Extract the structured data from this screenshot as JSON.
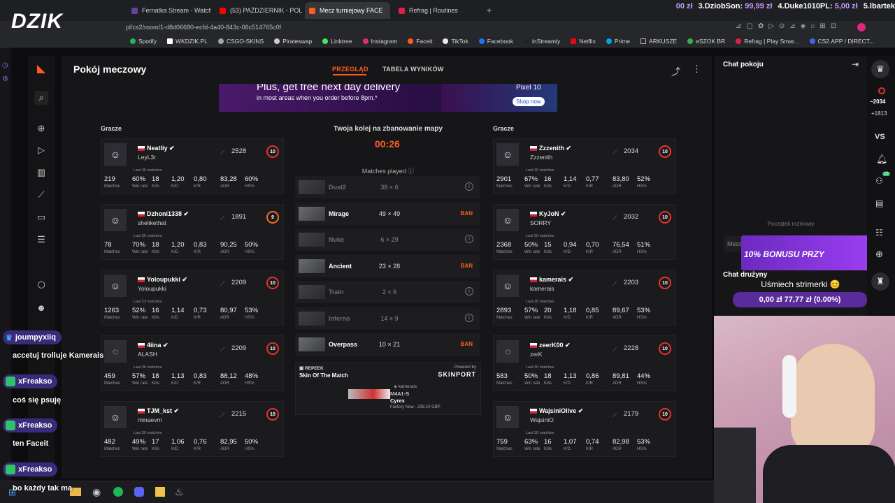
{
  "browser": {
    "tabs": [
      {
        "label": "Fernatka Stream - Watch"
      },
      {
        "label": "(53) PAŹDZIERNIK - POLS"
      },
      {
        "label": "Mecz turniejowy FACE"
      },
      {
        "label": "Refrag | Routines"
      }
    ],
    "url": "pl/cs2/room/1-d8d06680-ecfd-4a40-843c-06c514765c0f",
    "bookmarks": [
      "Spotify",
      "WKDZIK.PL",
      "CSGO-SKINS",
      "Pirateswap",
      "Linktree",
      "Instagram",
      "Faceit",
      "TikTok",
      "Facebook",
      "inStreamly",
      "Netflix",
      "Prime",
      "ARKUSZE",
      "eSZOK BR",
      "Refrag | Play Smar...",
      "CS2.APP / DIRECT..."
    ]
  },
  "stream": {
    "logo": "DZIK",
    "donations": [
      {
        "text": "00 zł"
      },
      {
        "rank": "3.DziobSon:",
        "amount": "99,99 zł"
      },
      {
        "rank": "4.Duke1010PL:",
        "amount": "5,00 zł"
      },
      {
        "rank": "5.lbartek",
        "amount": ""
      }
    ],
    "chat": [
      {
        "user": "joumpyxiiq",
        "msg": "accetuj trolluje Kamerais"
      },
      {
        "user": "xFreakso",
        "msg": "coś się psuję"
      },
      {
        "user": "xFreakso",
        "msg": "ten Faceit"
      },
      {
        "user": "xFreakso",
        "msg": "bo każdy tak ma"
      }
    ],
    "promo_text": "10% BONUSU PRZY",
    "goal_title": "Uśmiech strimerki 😊",
    "goal_progress": "0,00 zł  77,77 zł (0.00%)"
  },
  "page": {
    "title": "Pokój meczowy",
    "tab_overview": "PRZEGLĄD",
    "tab_scores": "TABELA WYNIKÓW",
    "banner": {
      "headline": "Plus, get free next day delivery",
      "sub": "in most areas when you order before 8pm.*",
      "product": "Pixel 10",
      "cta": "Shop now"
    },
    "players_label": "Gracze",
    "last30": "Last 30 matches",
    "last23": "Last 23 matches",
    "stat_labels": [
      "Matches",
      "Win rate",
      "Kills",
      "K/D",
      "K/R",
      "ADR",
      "HS%"
    ]
  },
  "team_left": [
    {
      "name": "Neatliy",
      "sub": "LeyL3r",
      "elo": "2528",
      "level": "10",
      "stats": [
        "219",
        "60%",
        "18",
        "1,20",
        "0,80",
        "83,28",
        "60%"
      ]
    },
    {
      "name": "Dzhoni1338",
      "sub": "shelikethat",
      "elo": "1891",
      "level": "9",
      "stats": [
        "78",
        "70%",
        "18",
        "1,20",
        "0,83",
        "90,25",
        "50%"
      ]
    },
    {
      "name": "Yoloupukki",
      "sub": "Yoloupukki",
      "elo": "2209",
      "level": "10",
      "stats": [
        "1263",
        "52%",
        "16",
        "1,14",
        "0,73",
        "80,97",
        "53%"
      ]
    },
    {
      "name": "4iina",
      "sub": "ALASH",
      "elo": "2209",
      "level": "10",
      "stats": [
        "459",
        "57%",
        "18",
        "1,13",
        "0,83",
        "88,12",
        "48%"
      ]
    },
    {
      "name": "TJM_kst",
      "sub": "minaevrn",
      "elo": "2215",
      "level": "10",
      "stats": [
        "482",
        "49%",
        "17",
        "1,06",
        "0,76",
        "82,95",
        "50%"
      ]
    }
  ],
  "team_right": [
    {
      "name": "Zzzenith",
      "sub": "Zzzenith",
      "elo": "2034",
      "level": "10",
      "stats": [
        "2901",
        "67%",
        "16",
        "1,14",
        "0,77",
        "83,80",
        "52%"
      ]
    },
    {
      "name": "KyJoN",
      "sub": "SORRY",
      "elo": "2032",
      "level": "10",
      "stats": [
        "2368",
        "50%",
        "15",
        "0,94",
        "0,70",
        "76,54",
        "51%"
      ]
    },
    {
      "name": "kamerais",
      "sub": "kamerais",
      "elo": "2203",
      "level": "10",
      "stats": [
        "2893",
        "57%",
        "20",
        "1,18",
        "0,85",
        "89,67",
        "53%"
      ]
    },
    {
      "name": "zeerK00",
      "sub": "zerK",
      "elo": "2228",
      "level": "10",
      "stats": [
        "583",
        "50%",
        "18",
        "1,13",
        "0,86",
        "89,81",
        "44%"
      ]
    },
    {
      "name": "WajsiniOlive",
      "sub": "WajsiniO",
      "elo": "2179",
      "level": "10",
      "stats": [
        "759",
        "63%",
        "16",
        "1,07",
        "0,74",
        "82,98",
        "53%"
      ]
    }
  ],
  "veto": {
    "title": "Twoja kolej na zbanowanie mapy",
    "timer": "00:26",
    "matches_played": "Matches played",
    "maps": [
      {
        "name": "Dust2",
        "score": "38 × 6",
        "action": "",
        "dim": true
      },
      {
        "name": "Mirage",
        "score": "49 × 49",
        "action": "BAN",
        "dim": false
      },
      {
        "name": "Nuke",
        "score": "6 × 29",
        "action": "",
        "dim": true
      },
      {
        "name": "Ancient",
        "score": "23 × 28",
        "action": "BAN",
        "dim": false
      },
      {
        "name": "Train",
        "score": "2 × 6",
        "action": "",
        "dim": true
      },
      {
        "name": "Inferno",
        "score": "14 × 9",
        "action": "",
        "dim": true
      },
      {
        "name": "Overpass",
        "score": "10 × 21",
        "action": "BAN",
        "dim": false
      }
    ]
  },
  "skin": {
    "brand": "REPEEK",
    "title": "Skin Of The Match",
    "powered": "Powered by",
    "partner": "SKINPORT",
    "owner": "kamerais",
    "weapon": "M4A1-S",
    "skin": "Cyrex",
    "condition": "Factory New - 208,10 GBP"
  },
  "chat_panel": {
    "room_title": "Chat pokoju",
    "conversation_start": "Początek rozmowy",
    "placeholder": "Message room",
    "team_chat": "Chat drużyny",
    "elo_display": "~2034",
    "elo_delta": "+1813",
    "vs": "VS",
    "notif_count": "29"
  },
  "colors": {
    "accent": "#ff5a1f",
    "level10": "#e5312b",
    "level9": "#f06a1c"
  }
}
